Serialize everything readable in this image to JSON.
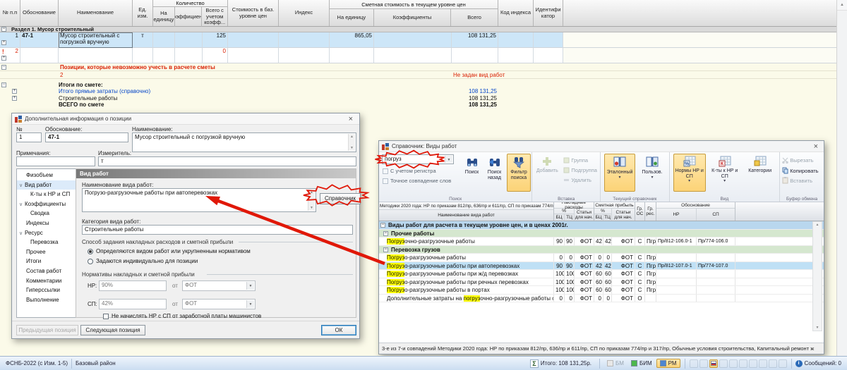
{
  "grid": {
    "header": {
      "num": "№ п.п",
      "basis": "Обоснование",
      "name": "Наименование",
      "unit": "Ед. изм.",
      "qty_group": "Количество",
      "qty_unit": "На единицу",
      "qty_coeff": "Коэффициен...",
      "qty_total": "Всего с учетом коэфф...",
      "base_cost": "Стоимость в баз. уровне цен",
      "index": "Индекс",
      "cur_group": "Сметная стоимость в текущем уровне цен",
      "cur_unit": "На единицу",
      "cur_coeff": "Коэффициенты",
      "cur_total": "Всего",
      "index_code": "Код индекса",
      "identifier": "Идентификатор"
    },
    "section": "Раздел 1. Мусор строительный",
    "row1": {
      "num": "1",
      "basis": "47-1",
      "name": "Мусор строительный с погрузкой вручную",
      "unit": "т",
      "qty_total": "125",
      "cur_unit": "865,05",
      "cur_total": "108 131,25"
    },
    "row2": {
      "num": "2",
      "qty_total": "0"
    },
    "impossible_title": "Позиции, которые невозможно учесть в расчете сметы",
    "impossible_num": "2",
    "impossible_note": "Не задан вид работ",
    "totals_title": "Итоги по смете:",
    "totals": [
      {
        "label": "Итого прямые затраты (справочно)",
        "value": "108 131,25"
      },
      {
        "label": "Строительные работы",
        "value": "108 131,25"
      },
      {
        "label": "ВСЕГО по смете",
        "value": "108 131,25"
      }
    ]
  },
  "dialog": {
    "title": "Дополнительная информация о позиции",
    "fields": {
      "num_label": "№",
      "num": "1",
      "basis_label": "Обоснование:",
      "basis": "47-1",
      "name_label": "Наименование:",
      "name": "Мусор строительный с погрузкой вручную",
      "notes_label": "Примечания:",
      "notes": "",
      "unit_label": "Измеритель:",
      "unit": "т"
    },
    "nav": [
      "Физобъем",
      "Вид работ",
      "К-ты к НР и СП",
      "Коэффициенты",
      "Сводка",
      "Индексы",
      "Ресурс",
      "Перевозка",
      "Прочее",
      "Итоги",
      "Состав работ",
      "Комментарии",
      "Гиперссылки",
      "Выполнение"
    ],
    "panel": {
      "title": "Вид работ",
      "work_name_label": "Наименование вида работ:",
      "work_name": "Погрузо-разгрузочные работы при автоперевозках",
      "reference_button": "Справочник",
      "category_label": "Категория вида работ:",
      "category": "Строительные работы",
      "method_label": "Способ задания накладных расходов и сметной прибыли",
      "radio1": "Определяются видом работ или укрупненным нормативом",
      "radio2": "Задаются индивидуально для позиции",
      "norms_label": "Нормативы накладных  и сметной прибыли",
      "nr_label": "НР:",
      "nr_value": "90%",
      "nr_from": "от",
      "nr_source": "ФОТ",
      "sp_label": "СП:",
      "sp_value": "42%",
      "sp_from": "от",
      "sp_source": "ФОТ",
      "checkbox": "Не начислять НР с СП от заработной платы машинистов"
    },
    "buttons": {
      "prev": "Предыдущая позиция",
      "next": "Следующая позиция",
      "ok": "ОК"
    }
  },
  "reference": {
    "title": "Справочник: Виды работ",
    "toolbar": {
      "search_value": "погруз",
      "case_checkbox": "С учетом регистра",
      "exact_checkbox": "Точное совпадение слов",
      "find": "Поиск",
      "find_back": "Поиск назад",
      "filter": "Фильтр поиска",
      "search_group": "Поиск",
      "add": "Добавить",
      "group": "Группа",
      "subgroup": "Подгруппа",
      "delete": "Удалить",
      "insert_group": "Вставка",
      "etalon": "Эталонный",
      "user": "Пользов.",
      "current_group": "Текущий справочник",
      "norms": "Нормы НР и СП",
      "coeffs": "К-ты к НР и СП",
      "categories": "Категории",
      "view_group": "Вид",
      "cut": "Вырезать",
      "copy": "Копировать",
      "paste": "Вставить",
      "clipboard_group": "Буфер обмена"
    },
    "table": {
      "methods_header": "Методики 2020 года: НР по приказам 812/пр, 636/пр и 611/пр, СП по приказам 774/пр и 317/пр",
      "name_header": "Наименование вида работ",
      "nr_header": "Накладные расходы",
      "sp_header": "Сметная прибыль",
      "pct": "%",
      "bc": "БЦ",
      "tc": "ТЦ",
      "items_header": "Статьи для нач.",
      "gr1": "Гр.",
      "gr1b": "ОС",
      "gr2": "Гр.",
      "gr2b": "рес.",
      "basis_header": "Обоснование",
      "basis_nr": "НР",
      "basis_sp": "СП",
      "group1": "Виды работ для расчета в текущем уровне цен, и в ценах 2001г.",
      "group2": "Прочие работы",
      "group3": "Перевозка грузов",
      "rows": [
        {
          "pre": "",
          "hl": "Погруз",
          "rest": "очно-разгрузочные работы",
          "nr_bc": "90",
          "nr_tc": "90",
          "nr_st": "ФОТ",
          "sp_bc": "42",
          "sp_tc": "42",
          "sp_st": "ФОТ",
          "gr_os": "С",
          "gr_res": "Пгр",
          "obo_nr": "Пр/812-106.0-1",
          "obo_sp": "Пр/774-106.0"
        },
        {
          "pre": "",
          "hl": "Погруз",
          "rest": "о-разгрузочные работы",
          "nr_bc": "0",
          "nr_tc": "0",
          "nr_st": "ФОТ",
          "sp_bc": "0",
          "sp_tc": "0",
          "sp_st": "ФОТ",
          "gr_os": "С",
          "gr_res": "Пгр",
          "obo_nr": "",
          "obo_sp": ""
        },
        {
          "pre": "",
          "hl": "Погруз",
          "rest": "о-разгрузочные работы при автоперевозках",
          "nr_bc": "90",
          "nr_tc": "90",
          "nr_st": "ФОТ",
          "sp_bc": "42",
          "sp_tc": "42",
          "sp_st": "ФОТ",
          "gr_os": "С",
          "gr_res": "Пгр",
          "obo_nr": "Пр/812-107.0-1",
          "obo_sp": "Пр/774-107.0"
        },
        {
          "pre": "",
          "hl": "Погруз",
          "rest": "о-разгрузочные работы при ж/д перевозках",
          "nr_bc": "100",
          "nr_tc": "100",
          "nr_st": "ФОТ",
          "sp_bc": "60",
          "sp_tc": "60",
          "sp_st": "ФОТ",
          "gr_os": "С",
          "gr_res": "Пгр",
          "obo_nr": "",
          "obo_sp": ""
        },
        {
          "pre": "",
          "hl": "Погруз",
          "rest": "о-разгрузочные работы при речных перевозках",
          "nr_bc": "100",
          "nr_tc": "100",
          "nr_st": "ФОТ",
          "sp_bc": "60",
          "sp_tc": "60",
          "sp_st": "ФОТ",
          "gr_os": "С",
          "gr_res": "Пгр",
          "obo_nr": "",
          "obo_sp": ""
        },
        {
          "pre": "",
          "hl": "Погруз",
          "rest": "о-разгрузочные работы в портах",
          "nr_bc": "100",
          "nr_tc": "100",
          "nr_st": "ФОТ",
          "sp_bc": "60",
          "sp_tc": "60",
          "sp_st": "ФОТ",
          "gr_os": "С",
          "gr_res": "Пгр",
          "obo_nr": "",
          "obo_sp": ""
        },
        {
          "pre": "Дополнительные затраты на ",
          "hl": "погруз",
          "rest": "очно-разгрузочные работы оборудования",
          "nr_bc": "0",
          "nr_tc": "0",
          "nr_st": "ФОТ",
          "sp_bc": "0",
          "sp_tc": "0",
          "sp_st": "ФОТ",
          "gr_os": "О",
          "gr_res": "",
          "obo_nr": "",
          "obo_sp": ""
        }
      ]
    },
    "status": "3-е из 7-и совпадений  Методики 2020 года: НР по приказам 812/пр, 636/пр и 611/пр, СП по приказам 774/пр и 317/пр, Обычные условия строительства, Капитальный ремонт ж"
  },
  "statusbar": {
    "db": "ФСНБ-2022 (с Изм. 1-5)",
    "region": "Базовый район",
    "total": "Итого: 108 131,25р.",
    "bm": "БМ",
    "bim": "БИМ",
    "rm": "РМ",
    "messages": "Сообщений: 0"
  }
}
